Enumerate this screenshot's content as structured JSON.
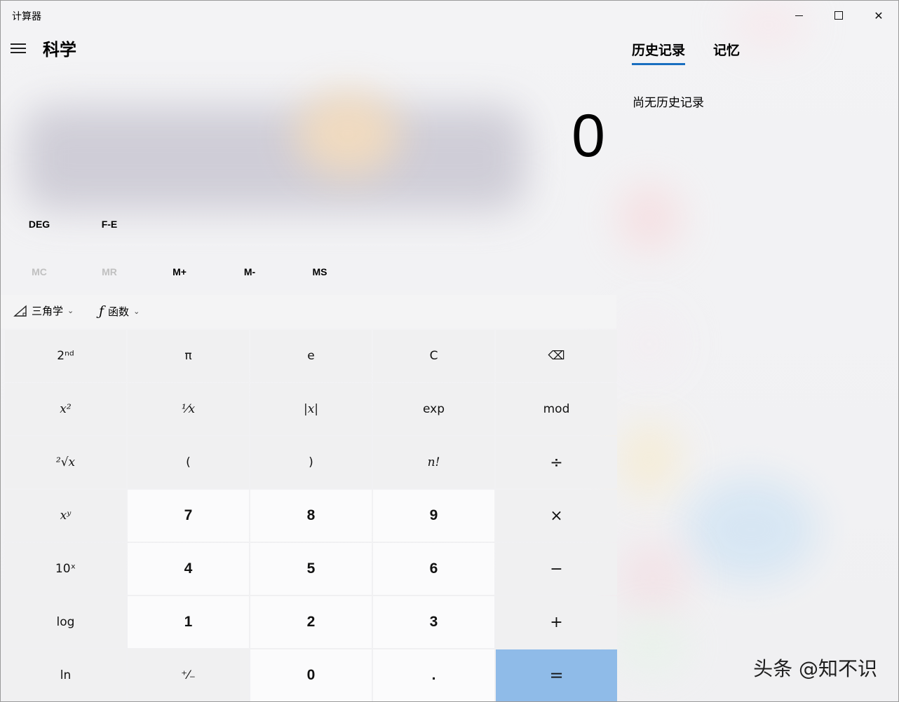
{
  "window": {
    "title": "计算器",
    "controls": {
      "minimize": "—",
      "maximize": "□",
      "close": "✕"
    }
  },
  "header": {
    "mode_title": "科学"
  },
  "display": {
    "value": "0"
  },
  "angle_modes": {
    "deg": "DEG",
    "fe": "F-E"
  },
  "memory": {
    "mc": "MC",
    "mr": "MR",
    "mplus": "M+",
    "mminus": "M-",
    "ms": "MS"
  },
  "functions_bar": {
    "trig": "三角学",
    "functions": "函数"
  },
  "keys": [
    {
      "label": "2ⁿᵈ",
      "name": "second-button",
      "style": "plain"
    },
    {
      "label": "π",
      "name": "pi-button",
      "style": "plain"
    },
    {
      "label": "e",
      "name": "euler-button",
      "style": "plain"
    },
    {
      "label": "C",
      "name": "clear-button",
      "style": "plain"
    },
    {
      "label": "⌫",
      "name": "backspace-button",
      "style": "plain"
    },
    {
      "label": "x²",
      "name": "square-button",
      "style": "func"
    },
    {
      "label": "¹⁄x",
      "name": "reciprocal-button",
      "style": "func"
    },
    {
      "label": "|x|",
      "name": "absolute-button",
      "style": "func"
    },
    {
      "label": "exp",
      "name": "exp-button",
      "style": "plain"
    },
    {
      "label": "mod",
      "name": "mod-button",
      "style": "plain"
    },
    {
      "label": "²√x",
      "name": "sqrt-button",
      "style": "func"
    },
    {
      "label": "(",
      "name": "open-paren-button",
      "style": "plain"
    },
    {
      "label": ")",
      "name": "close-paren-button",
      "style": "plain"
    },
    {
      "label": "n!",
      "name": "factorial-button",
      "style": "func"
    },
    {
      "label": "÷",
      "name": "divide-button",
      "style": "op"
    },
    {
      "label": "xʸ",
      "name": "power-button",
      "style": "func"
    },
    {
      "label": "7",
      "name": "digit-7-button",
      "style": "num"
    },
    {
      "label": "8",
      "name": "digit-8-button",
      "style": "num"
    },
    {
      "label": "9",
      "name": "digit-9-button",
      "style": "num"
    },
    {
      "label": "×",
      "name": "multiply-button",
      "style": "op"
    },
    {
      "label": "10ˣ",
      "name": "ten-power-button",
      "style": "plain"
    },
    {
      "label": "4",
      "name": "digit-4-button",
      "style": "num"
    },
    {
      "label": "5",
      "name": "digit-5-button",
      "style": "num"
    },
    {
      "label": "6",
      "name": "digit-6-button",
      "style": "num"
    },
    {
      "label": "−",
      "name": "subtract-button",
      "style": "op"
    },
    {
      "label": "log",
      "name": "log-button",
      "style": "plain"
    },
    {
      "label": "1",
      "name": "digit-1-button",
      "style": "num"
    },
    {
      "label": "2",
      "name": "digit-2-button",
      "style": "num"
    },
    {
      "label": "3",
      "name": "digit-3-button",
      "style": "num"
    },
    {
      "label": "+",
      "name": "add-button",
      "style": "op"
    },
    {
      "label": "ln",
      "name": "ln-button",
      "style": "plain"
    },
    {
      "label": "⁺⁄₋",
      "name": "negate-button",
      "style": "plain"
    },
    {
      "label": "0",
      "name": "digit-0-button",
      "style": "num"
    },
    {
      "label": ".",
      "name": "decimal-button",
      "style": "num"
    },
    {
      "label": "=",
      "name": "equals-button",
      "style": "eq"
    }
  ],
  "history_panel": {
    "tab_history": "历史记录",
    "tab_memory": "记忆",
    "empty_text": "尚无历史记录"
  },
  "watermark": "头条 @知不识",
  "colors": {
    "accent": "#1a6fc0",
    "equals_bg": "#8fbbe8"
  }
}
